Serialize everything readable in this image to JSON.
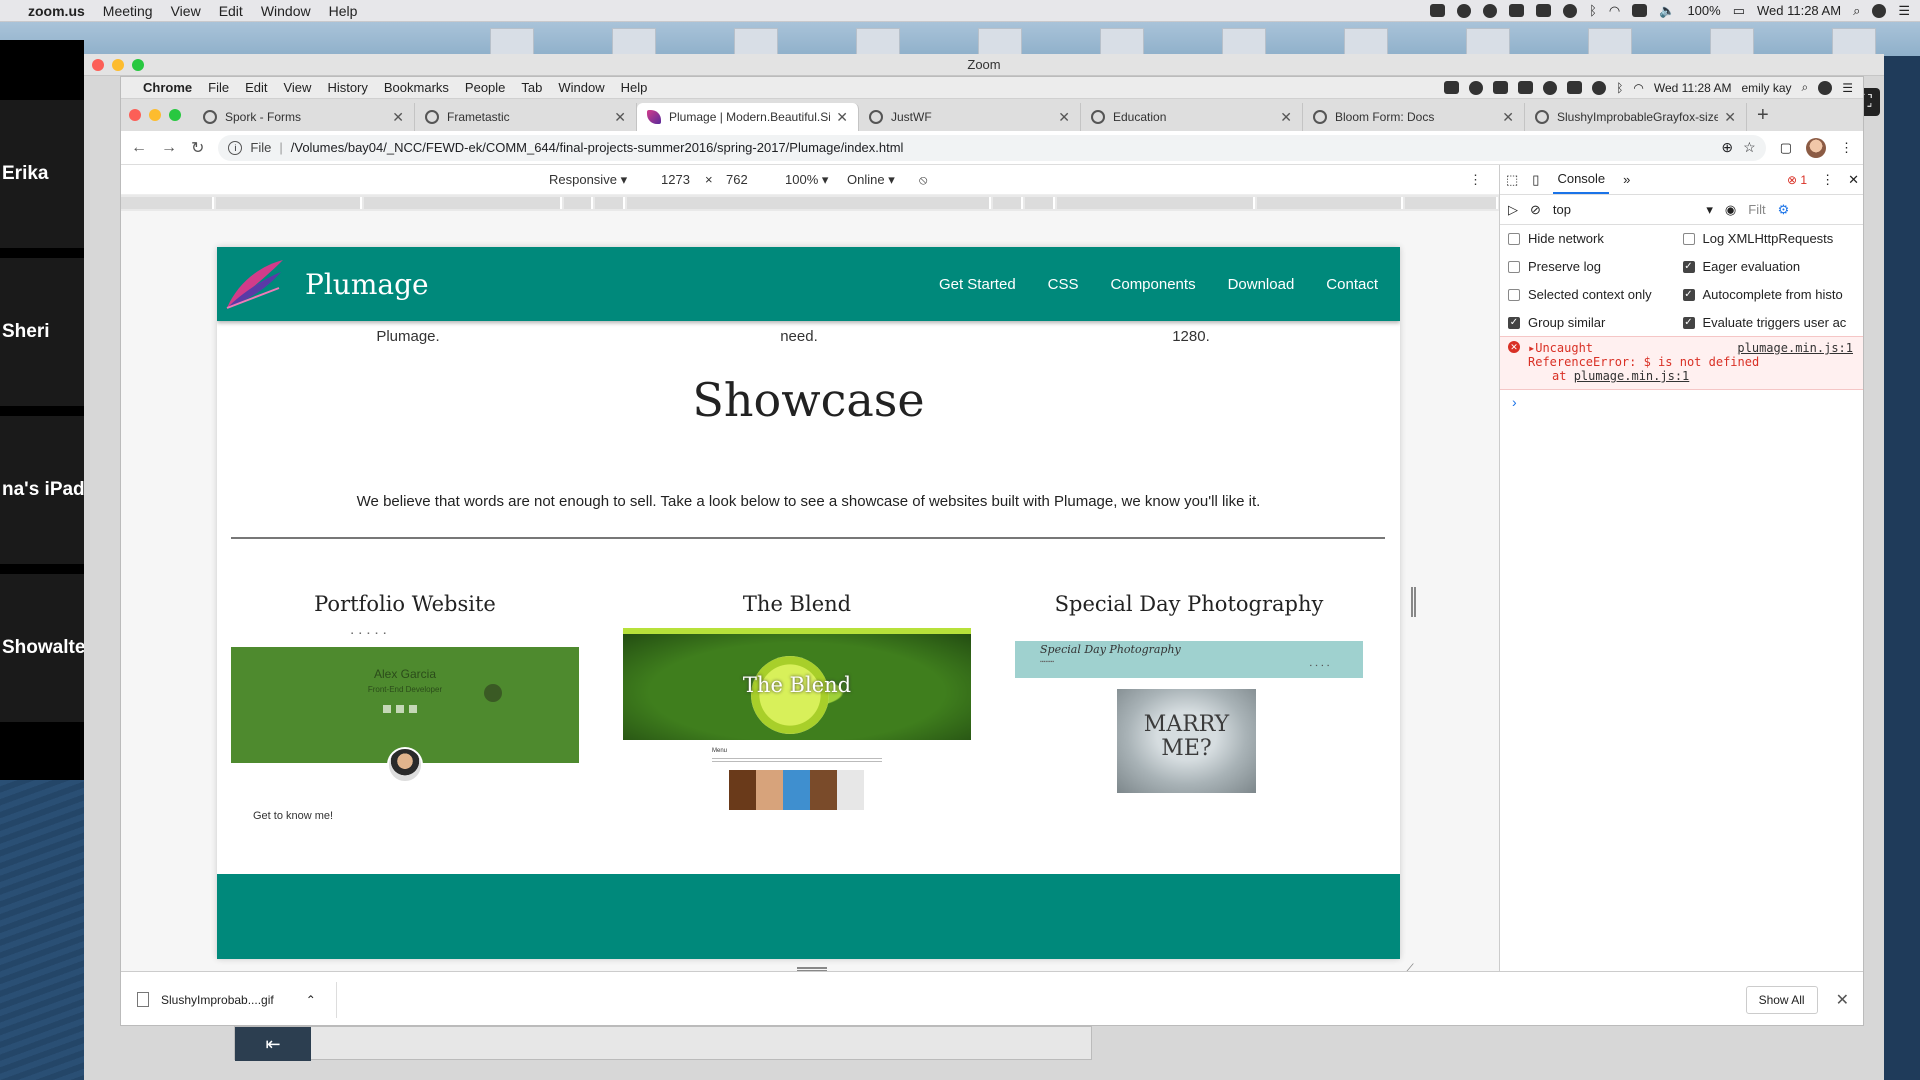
{
  "mac_menubar": {
    "app": "zoom.us",
    "menus": [
      "Meeting",
      "View",
      "Edit",
      "Window",
      "Help"
    ],
    "battery": "100%",
    "clock": "Wed 11:28 AM"
  },
  "zoom": {
    "window_title": "Zoom",
    "participants": [
      "Erika",
      "Sheri",
      "na's iPad",
      "Showalte"
    ]
  },
  "chrome": {
    "app": "Chrome",
    "menus": [
      "File",
      "Edit",
      "View",
      "History",
      "Bookmarks",
      "People",
      "Tab",
      "Window",
      "Help"
    ],
    "clock": "Wed 11:28 AM",
    "user": "emily kay",
    "tabs": [
      {
        "label": "Spork - Forms",
        "active": false
      },
      {
        "label": "Frametastic",
        "active": false
      },
      {
        "label": "Plumage | Modern.Beautiful.Si",
        "active": true
      },
      {
        "label": "JustWF",
        "active": false
      },
      {
        "label": "Education",
        "active": false
      },
      {
        "label": "Bloom Form: Docs",
        "active": false
      },
      {
        "label": "SlushyImprobableGrayfox-size",
        "active": false
      }
    ],
    "address": {
      "scheme": "File",
      "url": "/Volumes/bay04/_NCC/FEWD-ek/COMM_644/final-projects-summer2016/spring-2017/Plumage/index.html"
    }
  },
  "device_toolbar": {
    "mode": "Responsive",
    "width": "1273",
    "x": "×",
    "height": "762",
    "zoom": "100%",
    "network": "Online"
  },
  "plumage": {
    "brand": "Plumage",
    "nav": [
      "Get Started",
      "CSS",
      "Components",
      "Download",
      "Contact"
    ],
    "prev_texts": [
      "Plumage.",
      "need.",
      "1280."
    ],
    "showcase_title": "Showcase",
    "showcase_desc": "We believe that words are not enough to sell. Take a look below to see a showcase of websites built with Plumage, we know you'll like it.",
    "cards": [
      {
        "title": "Portfolio Website",
        "name": "Alex Garcia",
        "role": "Front-End Developer",
        "cta": "Get to know me!"
      },
      {
        "title": "The Blend",
        "hero_text": "The Blend",
        "menu_label": "Menu"
      },
      {
        "title": "Special Day Photography",
        "header": "Special Day Photography",
        "photo_text": "MARRY ME?"
      }
    ]
  },
  "devtools": {
    "tab": "Console",
    "error_count": "1",
    "context": "top",
    "filter": "Filt",
    "options_left": [
      {
        "label": "Hide network",
        "checked": false
      },
      {
        "label": "Preserve log",
        "checked": false
      },
      {
        "label": "Selected context only",
        "checked": false
      },
      {
        "label": "Group similar",
        "checked": true
      }
    ],
    "options_right": [
      {
        "label": "Log XMLHttpRequests",
        "checked": false
      },
      {
        "label": "Eager evaluation",
        "checked": true
      },
      {
        "label": "Autocomplete from histo",
        "checked": true
      },
      {
        "label": "Evaluate triggers user ac",
        "checked": true
      }
    ],
    "error": {
      "head": "Uncaught",
      "source": "plumage.min.js:1",
      "message": "ReferenceError: $ is not defined",
      "at_prefix": "at",
      "at_source": "plumage.min.js:1"
    },
    "prompt": "›"
  },
  "download_shelf": {
    "file": "SlushyImprobab....gif",
    "show_all": "Show All"
  }
}
